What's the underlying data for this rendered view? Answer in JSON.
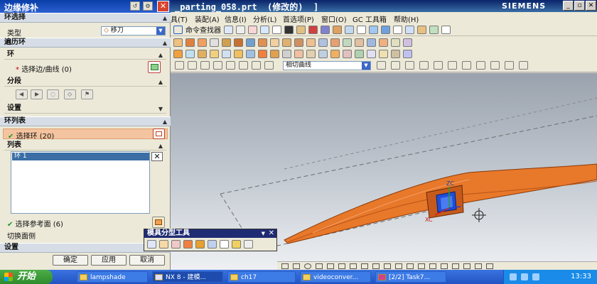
{
  "window": {
    "title": "_parting_058.prt  (修改的)  ]",
    "brand": "SIEMENS"
  },
  "menubar": {
    "items": [
      "具(T)",
      "装配(A)",
      "信息(I)",
      "分析(L)",
      "首选项(P)",
      "窗口(O)",
      "GC 工具箱",
      "帮助(H)"
    ],
    "command_finder": "命令查找器"
  },
  "selection_bar": {
    "curve_rule": "相切曲线"
  },
  "dialog": {
    "title": "边缘修补",
    "section_loop_select": "环选择",
    "type_label": "类型",
    "type_value": "移刀",
    "section_traverse": "遍历环",
    "sub_loop": "环",
    "select_edge_label": "选择边/曲线 (0)",
    "sub_segment": "分段",
    "sub_settings": "设置",
    "section_loop_list": "环列表",
    "select_loop_label": "选择环 (20)",
    "sub_list": "列表",
    "list_items": [
      "环 1"
    ],
    "select_ref_face_label": "选择参考面 (6)",
    "toggle_face_side": "切换面侧",
    "section_settings": "设置",
    "buttons": {
      "ok": "确定",
      "apply": "应用",
      "cancel": "取消"
    }
  },
  "mold_toolbar": {
    "title": "模具分型工具"
  },
  "viewport": {
    "axis_labels": [
      "ZC",
      "XC"
    ]
  },
  "taskbar": {
    "start": "开始",
    "tasks": [
      "lampshade",
      "NX 8 - 建模...",
      "ch17",
      "videoconver...",
      "[2/2] Task7..."
    ],
    "clock": "13:33"
  },
  "colors": {
    "part_orange": "#e8782a",
    "dialog_title_blue": "#0a3fa8",
    "highlight_row": "#f4c4a0",
    "taskbar_blue": "#2b62d6"
  }
}
